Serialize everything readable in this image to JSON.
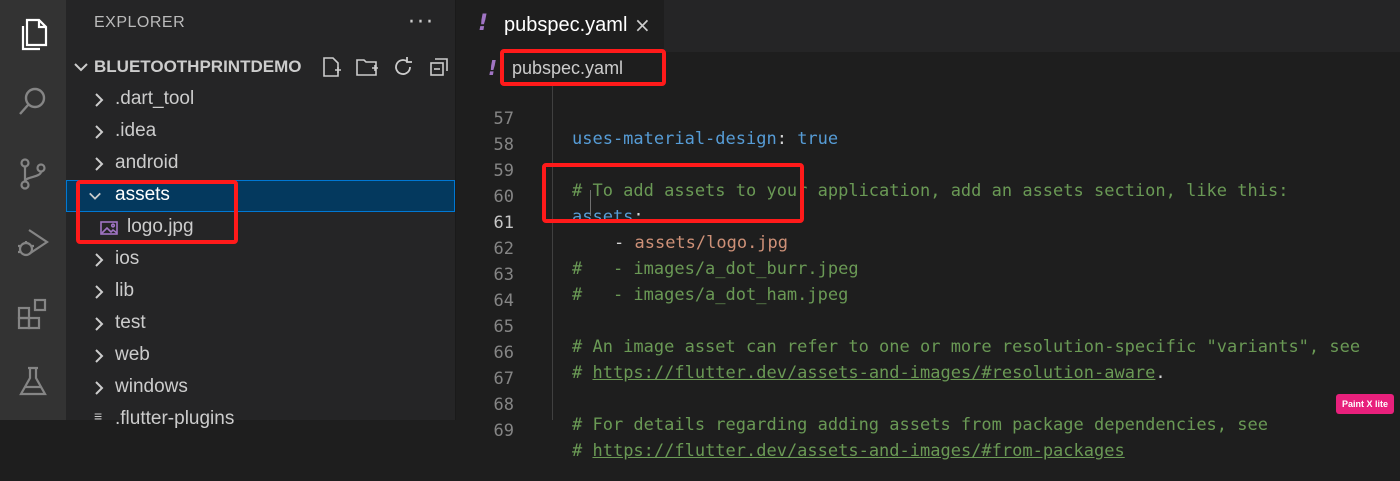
{
  "sidebar": {
    "header": "EXPLORER",
    "more": "···",
    "project": "BLUETOOTHPRINTDEMO",
    "items": [
      {
        "label": ".dart_tool"
      },
      {
        "label": ".idea"
      },
      {
        "label": "android"
      },
      {
        "label": "assets"
      },
      {
        "label": "logo.jpg"
      },
      {
        "label": "ios"
      },
      {
        "label": "lib"
      },
      {
        "label": "test"
      },
      {
        "label": "web"
      },
      {
        "label": "windows"
      },
      {
        "label": ".flutter-plugins"
      }
    ]
  },
  "editor": {
    "tab": {
      "icon": "!",
      "label": "pubspec.yaml",
      "close": "×"
    },
    "breadcrumb": {
      "icon": "!",
      "label": "pubspec.yaml"
    },
    "lines": [
      {
        "n": "57"
      },
      {
        "n": "58"
      },
      {
        "n": "59"
      },
      {
        "n": "60"
      },
      {
        "n": "61"
      },
      {
        "n": "62"
      },
      {
        "n": "63"
      },
      {
        "n": "64"
      },
      {
        "n": "65"
      },
      {
        "n": "66"
      },
      {
        "n": "67"
      },
      {
        "n": "68"
      },
      {
        "n": "69"
      }
    ],
    "code": {
      "l57_key": "uses-material-design",
      "l57_colon": ": ",
      "l57_val": "true",
      "l59": "# To add assets to your application, add an assets section, like this:",
      "l60_key": "assets",
      "l60_colon": ":",
      "l61_dash": "- ",
      "l61_val": "assets/logo.jpg",
      "l62": "#   - images/a_dot_burr.jpeg",
      "l63": "#   - images/a_dot_ham.jpeg",
      "l65": "# An image asset can refer to one or more resolution-specific \"variants\", see",
      "l66_hash": "# ",
      "l66_url": "https://flutter.dev/assets-and-images/#resolution-aware",
      "l66_dot": ".",
      "l68": "# For details regarding adding assets from package dependencies, see",
      "l69_hash": "# ",
      "l69_url": "https://flutter.dev/assets-and-images/#from-packages"
    }
  },
  "watermark": "Paint X lite",
  "colors": {
    "highlight": "#ff1a1a",
    "selection": "#04395e",
    "yaml_icon": "#a074c4"
  }
}
